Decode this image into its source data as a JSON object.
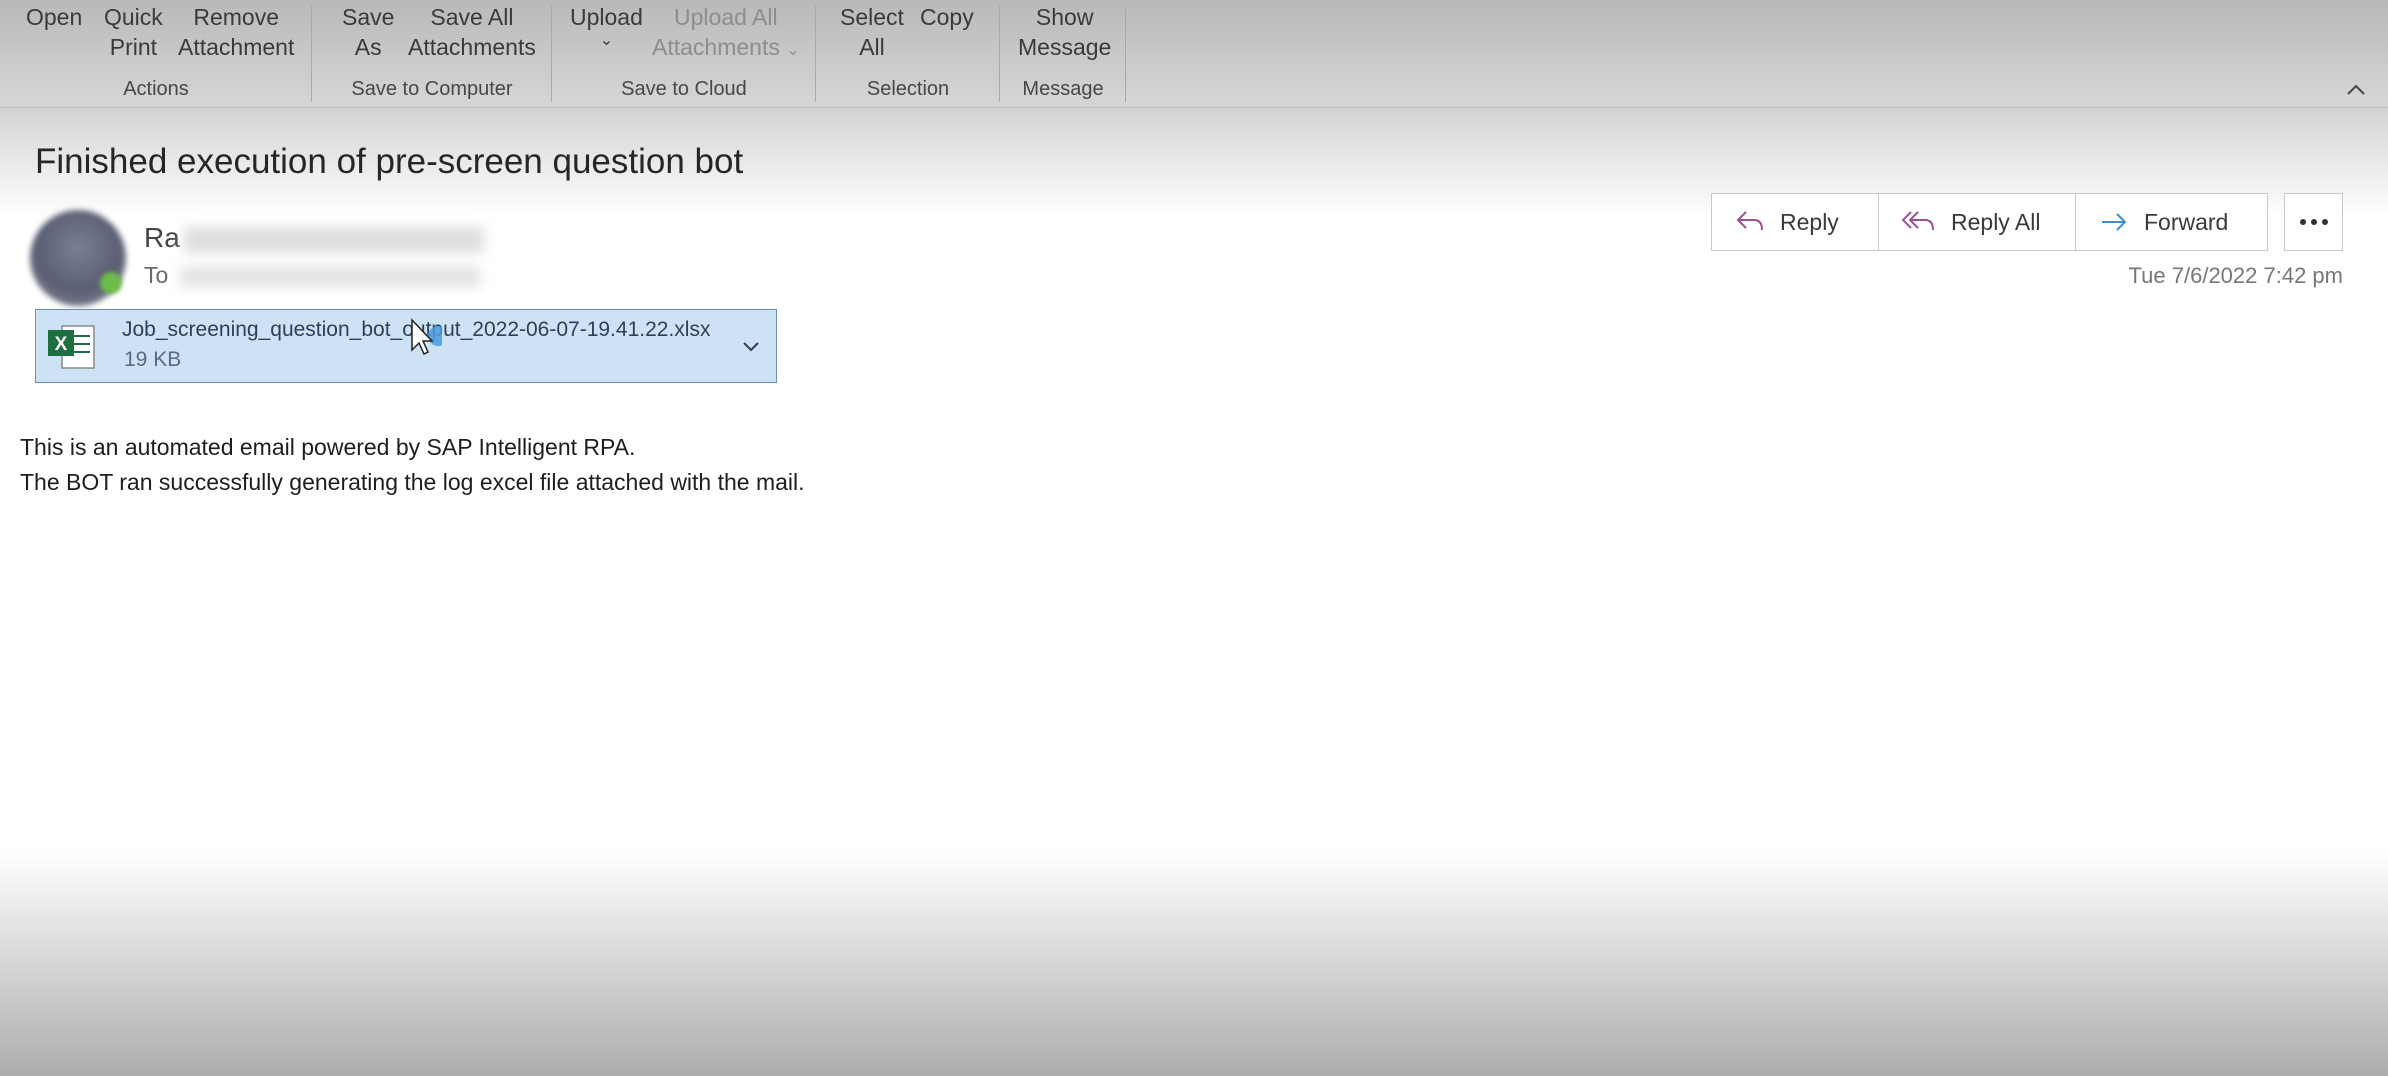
{
  "ribbon": {
    "groups": [
      {
        "label": "Actions",
        "buttons": [
          {
            "label": "Open"
          },
          {
            "label": "Quick Print",
            "line1": "Quick",
            "line2": "Print"
          },
          {
            "label": "Remove Attachment",
            "line1": "Remove",
            "line2": "Attachment"
          }
        ]
      },
      {
        "label": "Save to Computer",
        "buttons": [
          {
            "line1": "Save",
            "line2": "As"
          },
          {
            "line1": "Save All",
            "line2": "Attachments"
          }
        ]
      },
      {
        "label": "Save to Cloud",
        "buttons": [
          {
            "line1": "Upload"
          },
          {
            "line1": "Upload All",
            "line2": "Attachments",
            "disabled": true
          }
        ]
      },
      {
        "label": "Selection",
        "buttons": [
          {
            "line1": "Select",
            "line2": "All"
          },
          {
            "line1": "Copy"
          }
        ]
      },
      {
        "label": "Message",
        "buttons": [
          {
            "line1": "Show",
            "line2": "Message"
          }
        ]
      }
    ]
  },
  "email": {
    "subject": "Finished execution of pre-screen question bot",
    "sender_visible": "Ra",
    "to_label": "To",
    "date": "Tue 7/6/2022 7:42 pm",
    "actions": {
      "reply": "Reply",
      "reply_all": "Reply All",
      "forward": "Forward"
    },
    "attachment": {
      "name": "Job_screening_question_bot_output_2022-06-07-19.41.22.xlsx",
      "size": "19 KB"
    },
    "body": [
      "This is an automated email powered by SAP Intelligent RPA.",
      "The BOT ran successfully generating the log excel file attached with the mail."
    ]
  },
  "colors": {
    "ribbon_bg": "#c8c8c8",
    "attachment_bg": "#cde2f4",
    "reply_icon": "#9b4f96",
    "forward_icon": "#3d8fd1",
    "excel_green": "#1d6f42"
  }
}
